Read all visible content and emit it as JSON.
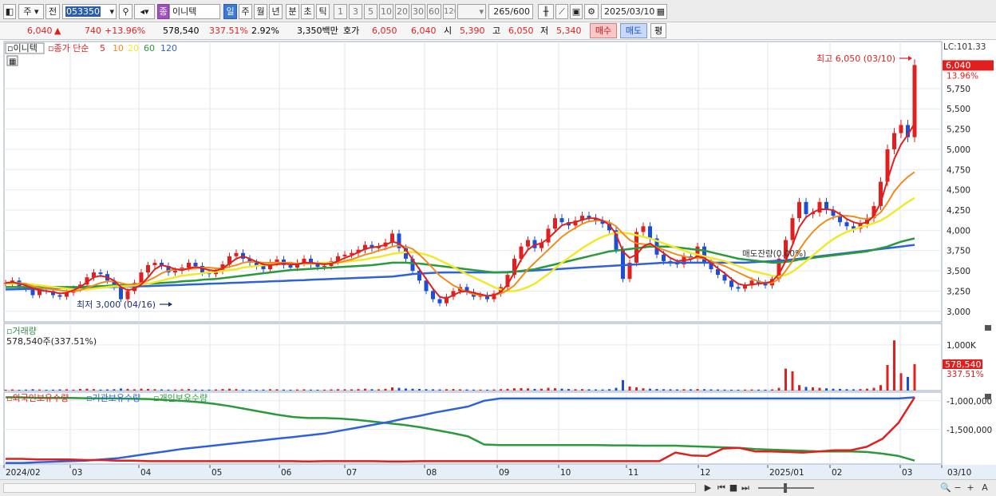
{
  "toolbar": {
    "market": "주",
    "prev_label": "전",
    "code": "053350",
    "stock_badge": "종",
    "stock_name": "이니텍",
    "periods": [
      "일",
      "주",
      "월",
      "년",
      "분",
      "초",
      "틱"
    ],
    "active_period": "일",
    "intervals": [
      "1",
      "3",
      "5",
      "10",
      "20",
      "30",
      "60",
      "120"
    ],
    "count": "265",
    "count_total": "/600",
    "date": "2025/03/10"
  },
  "quote": {
    "price": "6,040",
    "arrow": "▲",
    "change": "740",
    "change_pct": "+13.96%",
    "volume": "578,540",
    "volume_ratio": "337.51%",
    "turnover": "2.92%",
    "amount": "3,350백만",
    "ask_label": "호가",
    "ask": "6,050",
    "bid": "6,040",
    "open_label": "시",
    "open": "5,390",
    "high_label": "고",
    "high": "6,050",
    "low_label": "저",
    "low": "5,340",
    "buy_label": "매수",
    "sell_label": "매도",
    "avg_label": "평"
  },
  "colors": {
    "up": "#e0201e",
    "down": "#1b4fd8",
    "ma5": "#e0201e",
    "ma10": "#f08c1e",
    "ma20": "#f2e82a",
    "ma60": "#2a9a3c",
    "ma120": "#2f62d8",
    "foreign": "#e0201e",
    "institution": "#2f62d8",
    "individual": "#2a9a3c"
  },
  "chart_data": [
    {
      "type": "candlestick",
      "legend": {
        "name": "이니텍",
        "ma_title": "종가 단순",
        "periods": [
          "5",
          "10",
          "20",
          "60",
          "120"
        ]
      },
      "x_labels": [
        "2024/02",
        "03",
        "04",
        "05",
        "06",
        "07",
        "08",
        "09",
        "10",
        "11",
        "12",
        "2025/01",
        "02",
        "03",
        "03/10"
      ],
      "y_ticks": [
        "5,750",
        "5,500",
        "5,250",
        "5,000",
        "4,750",
        "4,500",
        "4,250",
        "4,000",
        "3,750",
        "3,500",
        "3,250",
        "3,000"
      ],
      "ylim": [
        2870,
        6330
      ],
      "top_label": "LC:101.33",
      "current_price_label": "6,040",
      "current_pct_label": "13.96%",
      "annotations": {
        "high": "최고 6,050 (03/10)",
        "low": "최저 3,000 (04/16)",
        "mid": "매도잔량(0.00%)"
      },
      "close_series": [
        3350,
        3380,
        3310,
        3280,
        3200,
        3260,
        3250,
        3200,
        3180,
        3230,
        3280,
        3330,
        3420,
        3480,
        3460,
        3380,
        3300,
        3150,
        3250,
        3350,
        3480,
        3570,
        3600,
        3560,
        3480,
        3500,
        3540,
        3600,
        3560,
        3480,
        3460,
        3500,
        3580,
        3680,
        3720,
        3650,
        3600,
        3560,
        3520,
        3600,
        3640,
        3570,
        3540,
        3600,
        3650,
        3580,
        3550,
        3560,
        3620,
        3680,
        3700,
        3720,
        3760,
        3820,
        3780,
        3800,
        3850,
        3960,
        3780,
        3650,
        3500,
        3380,
        3250,
        3150,
        3100,
        3180,
        3250,
        3300,
        3240,
        3180,
        3200,
        3150,
        3220,
        3300,
        3450,
        3650,
        3800,
        3880,
        3780,
        3850,
        4020,
        4150,
        4100,
        4060,
        4120,
        4180,
        4150,
        4120,
        4080,
        4000,
        3760,
        3400,
        3600,
        3980,
        4050,
        3900,
        3700,
        3620,
        3600,
        3580,
        3680,
        3650,
        3800,
        3600,
        3520,
        3450,
        3380,
        3300,
        3280,
        3320,
        3380,
        3350,
        3320,
        3400,
        3650,
        3880,
        4150,
        4350,
        4200,
        4220,
        4350,
        4250,
        4180,
        4100,
        4050,
        4020,
        4080,
        4150,
        4300,
        4600,
        5000,
        5200,
        5300,
        5150,
        6040
      ],
      "ma5_series": [
        3350,
        3360,
        3340,
        3320,
        3280,
        3260,
        3250,
        3240,
        3220,
        3230,
        3260,
        3300,
        3360,
        3420,
        3440,
        3420,
        3380,
        3300,
        3260,
        3280,
        3330,
        3420,
        3520,
        3570,
        3550,
        3520,
        3510,
        3530,
        3550,
        3530,
        3510,
        3500,
        3530,
        3590,
        3650,
        3680,
        3650,
        3610,
        3580,
        3570,
        3580,
        3590,
        3580,
        3580,
        3600,
        3600,
        3590,
        3580,
        3590,
        3620,
        3660,
        3690,
        3730,
        3770,
        3790,
        3800,
        3820,
        3860,
        3840,
        3760,
        3640,
        3520,
        3400,
        3280,
        3180,
        3160,
        3200,
        3240,
        3250,
        3230,
        3210,
        3190,
        3200,
        3240,
        3330,
        3480,
        3640,
        3760,
        3820,
        3840,
        3900,
        3980,
        4060,
        4090,
        4100,
        4130,
        4150,
        4150,
        4120,
        4070,
        3950,
        3740,
        3660,
        3700,
        3800,
        3840,
        3780,
        3720,
        3660,
        3620,
        3630,
        3640,
        3680,
        3660,
        3600,
        3530,
        3470,
        3400,
        3340,
        3320,
        3330,
        3340,
        3350,
        3370,
        3460,
        3620,
        3820,
        4040,
        4160,
        4220,
        4260,
        4260,
        4250,
        4200,
        4140,
        4100,
        4080,
        4100,
        4180,
        4340,
        4620,
        4880,
        5060,
        5180,
        5320
      ],
      "ma10_series": [
        3350,
        3355,
        3350,
        3340,
        3310,
        3290,
        3280,
        3270,
        3260,
        3250,
        3250,
        3260,
        3290,
        3320,
        3350,
        3370,
        3370,
        3350,
        3330,
        3330,
        3350,
        3380,
        3420,
        3470,
        3500,
        3520,
        3520,
        3520,
        3530,
        3540,
        3540,
        3530,
        3530,
        3550,
        3570,
        3600,
        3610,
        3610,
        3600,
        3600,
        3600,
        3600,
        3600,
        3590,
        3590,
        3590,
        3590,
        3590,
        3590,
        3600,
        3620,
        3640,
        3670,
        3700,
        3720,
        3750,
        3770,
        3800,
        3810,
        3800,
        3770,
        3700,
        3620,
        3530,
        3440,
        3380,
        3320,
        3280,
        3240,
        3210,
        3200,
        3190,
        3200,
        3220,
        3260,
        3320,
        3420,
        3520,
        3600,
        3680,
        3760,
        3840,
        3920,
        3980,
        4030,
        4080,
        4110,
        4120,
        4120,
        4100,
        4050,
        3960,
        3880,
        3840,
        3830,
        3820,
        3790,
        3760,
        3730,
        3700,
        3680,
        3660,
        3660,
        3650,
        3620,
        3590,
        3560,
        3520,
        3480,
        3440,
        3400,
        3370,
        3350,
        3350,
        3400,
        3500,
        3620,
        3760,
        3880,
        3980,
        4060,
        4120,
        4160,
        4180,
        4180,
        4170,
        4150,
        4140,
        4160,
        4220,
        4340,
        4480,
        4580,
        4660,
        4720
      ],
      "ma20_series": [
        3340,
        3340,
        3340,
        3335,
        3330,
        3320,
        3310,
        3300,
        3290,
        3280,
        3270,
        3270,
        3270,
        3280,
        3290,
        3300,
        3310,
        3310,
        3310,
        3320,
        3330,
        3340,
        3360,
        3380,
        3400,
        3420,
        3440,
        3450,
        3460,
        3470,
        3480,
        3490,
        3500,
        3510,
        3520,
        3540,
        3550,
        3560,
        3570,
        3580,
        3580,
        3590,
        3590,
        3590,
        3590,
        3590,
        3595,
        3600,
        3600,
        3600,
        3610,
        3620,
        3630,
        3640,
        3660,
        3670,
        3690,
        3710,
        3720,
        3730,
        3730,
        3720,
        3700,
        3670,
        3630,
        3590,
        3550,
        3500,
        3460,
        3420,
        3380,
        3340,
        3300,
        3270,
        3250,
        3250,
        3270,
        3300,
        3340,
        3400,
        3460,
        3530,
        3600,
        3660,
        3720,
        3780,
        3830,
        3880,
        3920,
        3950,
        3970,
        3970,
        3960,
        3940,
        3920,
        3900,
        3870,
        3840,
        3810,
        3780,
        3750,
        3720,
        3700,
        3680,
        3660,
        3640,
        3620,
        3590,
        3560,
        3530,
        3500,
        3480,
        3460,
        3440,
        3430,
        3450,
        3490,
        3550,
        3620,
        3690,
        3760,
        3830,
        3890,
        3940,
        3980,
        4010,
        4040,
        4060,
        4090,
        4120,
        4170,
        4230,
        4290,
        4350,
        4400
      ],
      "ma60_series": [
        3300,
        3300,
        3300,
        3300,
        3300,
        3300,
        3300,
        3300,
        3300,
        3300,
        3300,
        3300,
        3305,
        3310,
        3310,
        3315,
        3320,
        3320,
        3325,
        3330,
        3335,
        3340,
        3345,
        3350,
        3355,
        3360,
        3370,
        3375,
        3380,
        3390,
        3395,
        3400,
        3410,
        3420,
        3430,
        3440,
        3450,
        3460,
        3470,
        3480,
        3490,
        3500,
        3510,
        3515,
        3520,
        3525,
        3530,
        3535,
        3540,
        3545,
        3550,
        3555,
        3560,
        3565,
        3570,
        3580,
        3590,
        3600,
        3600,
        3600,
        3595,
        3590,
        3580,
        3570,
        3560,
        3550,
        3540,
        3530,
        3520,
        3510,
        3500,
        3490,
        3480,
        3480,
        3480,
        3490,
        3500,
        3510,
        3520,
        3540,
        3560,
        3580,
        3600,
        3620,
        3640,
        3660,
        3680,
        3700,
        3720,
        3740,
        3750,
        3760,
        3770,
        3780,
        3790,
        3800,
        3800,
        3800,
        3800,
        3790,
        3780,
        3770,
        3760,
        3750,
        3730,
        3710,
        3690,
        3670,
        3650,
        3640,
        3630,
        3620,
        3610,
        3600,
        3600,
        3610,
        3620,
        3640,
        3650,
        3660,
        3670,
        3680,
        3690,
        3700,
        3710,
        3720,
        3730,
        3740,
        3760,
        3780,
        3800,
        3830,
        3860,
        3880,
        3900
      ],
      "ma120_series": [
        3270,
        3272,
        3274,
        3276,
        3278,
        3280,
        3282,
        3284,
        3286,
        3288,
        3290,
        3292,
        3294,
        3296,
        3298,
        3300,
        3302,
        3304,
        3306,
        3308,
        3310,
        3312,
        3315,
        3318,
        3320,
        3323,
        3326,
        3330,
        3333,
        3336,
        3340,
        3343,
        3346,
        3350,
        3353,
        3356,
        3360,
        3363,
        3366,
        3370,
        3373,
        3376,
        3380,
        3383,
        3386,
        3390,
        3393,
        3396,
        3400,
        3403,
        3406,
        3410,
        3413,
        3416,
        3420,
        3423,
        3426,
        3430,
        3440,
        3450,
        3460,
        3465,
        3470,
        3475,
        3478,
        3480,
        3480,
        3480,
        3480,
        3480,
        3480,
        3480,
        3480,
        3482,
        3485,
        3490,
        3495,
        3500,
        3505,
        3510,
        3515,
        3520,
        3525,
        3530,
        3535,
        3540,
        3545,
        3550,
        3555,
        3560,
        3565,
        3570,
        3575,
        3580,
        3585,
        3590,
        3595,
        3600,
        3600,
        3600,
        3600,
        3600,
        3600,
        3600,
        3600,
        3600,
        3600,
        3600,
        3600,
        3600,
        3605,
        3610,
        3615,
        3620,
        3625,
        3630,
        3640,
        3650,
        3660,
        3670,
        3680,
        3690,
        3700,
        3710,
        3720,
        3730,
        3740,
        3750,
        3760,
        3770,
        3780,
        3790,
        3800,
        3810,
        3820
      ]
    },
    {
      "type": "bar",
      "title": "거래량",
      "summary": "578,540주(337.51%)",
      "y_ticks": [
        "1,000K"
      ],
      "ylim": [
        0,
        1400000
      ],
      "current_label": "578,540",
      "current_pct_label": "337.51%",
      "values": [
        20000,
        25000,
        18000,
        22000,
        30000,
        24000,
        19000,
        21000,
        26000,
        28000,
        20000,
        35000,
        40000,
        32000,
        22000,
        25000,
        30000,
        45000,
        38000,
        28000,
        42000,
        36000,
        30000,
        26000,
        22000,
        24000,
        28000,
        33000,
        25000,
        20000,
        22000,
        26000,
        34000,
        40000,
        32000,
        24000,
        21000,
        20000,
        23000,
        30000,
        28000,
        22000,
        20000,
        24000,
        27000,
        22000,
        20000,
        21000,
        26000,
        30000,
        28000,
        27000,
        32000,
        40000,
        30000,
        28000,
        38000,
        70000,
        60000,
        45000,
        40000,
        36000,
        30000,
        28000,
        25000,
        30000,
        34000,
        28000,
        24000,
        22000,
        22000,
        20000,
        24000,
        30000,
        38000,
        50000,
        55000,
        48000,
        36000,
        40000,
        60000,
        52000,
        42000,
        34000,
        30000,
        32000,
        28000,
        26000,
        24000,
        30000,
        60000,
        230000,
        90000,
        70000,
        50000,
        40000,
        34000,
        30000,
        28000,
        26000,
        30000,
        28000,
        34000,
        30000,
        26000,
        24000,
        22000,
        20000,
        20000,
        22000,
        24000,
        22000,
        20000,
        26000,
        60000,
        480000,
        420000,
        120000,
        80000,
        70000,
        60000,
        50000,
        40000,
        36000,
        30000,
        28000,
        32000,
        40000,
        60000,
        120000,
        560000,
        1100000,
        380000,
        300000,
        578540
      ]
    },
    {
      "type": "line",
      "series": [
        {
          "name": "외국인보유수량",
          "color": "#e0201e"
        },
        {
          "name": "기관보유수량",
          "color": "#2f62d8"
        },
        {
          "name": "개인보유수량",
          "color": "#2a9a3c"
        }
      ],
      "y_ticks": [
        "-1,000,000",
        "-1,500,000"
      ],
      "ylim": [
        -2100000,
        -850000
      ],
      "foreign_values": [
        -2010000,
        -2010000,
        -2020000,
        -2020000,
        -2020000,
        -2030000,
        -2030000,
        -2040000,
        -2040000,
        -2050000,
        -2050000,
        -2050000,
        -2050000,
        -2050000,
        -2050000,
        -2050000,
        -2050000,
        -2050000,
        -2050000,
        -2055000,
        -2050000,
        -2050000,
        -2050000,
        -2050000,
        -2055000,
        -2055000,
        -2050000,
        -2050000,
        -2050000,
        -2050000,
        -2050000,
        -2050000,
        -2050000,
        -2050000,
        -2050000,
        -2050000,
        -2050000,
        -2050000,
        -2050000,
        -2050000,
        -2050000,
        -2050000,
        -1900000,
        -1950000,
        -1960000,
        -1830000,
        -1820000,
        -1880000,
        -1880000,
        -1890000,
        -1900000,
        -1880000,
        -1860000,
        -1860000,
        -1800000,
        -1660000,
        -1380000,
        -940000
      ],
      "institution_values": [
        -2080000,
        -2080000,
        -2070000,
        -2060000,
        -2050000,
        -2040000,
        -2020000,
        -2000000,
        -1960000,
        -1920000,
        -1880000,
        -1840000,
        -1810000,
        -1780000,
        -1750000,
        -1720000,
        -1690000,
        -1660000,
        -1630000,
        -1600000,
        -1570000,
        -1520000,
        -1470000,
        -1420000,
        -1370000,
        -1310000,
        -1260000,
        -1200000,
        -1150000,
        -1100000,
        -1000000,
        -960000,
        -960000,
        -960000,
        -960000,
        -960000,
        -960000,
        -960000,
        -960000,
        -960000,
        -960000,
        -960000,
        -960000,
        -960000,
        -960000,
        -960000,
        -960000,
        -960000,
        -960000,
        -960000,
        -960000,
        -960000,
        -960000,
        -960000,
        -960000,
        -960000,
        -960000,
        -940000
      ],
      "individual_values": [
        -940000,
        -940000,
        -950000,
        -950000,
        -950000,
        -955000,
        -960000,
        -960000,
        -965000,
        -970000,
        -985000,
        -1000000,
        -1020000,
        -1050000,
        -1090000,
        -1140000,
        -1190000,
        -1240000,
        -1280000,
        -1300000,
        -1300000,
        -1310000,
        -1330000,
        -1360000,
        -1390000,
        -1420000,
        -1460000,
        -1510000,
        -1560000,
        -1620000,
        -1760000,
        -1770000,
        -1770000,
        -1770000,
        -1770000,
        -1770000,
        -1770000,
        -1770000,
        -1775000,
        -1775000,
        -1780000,
        -1780000,
        -1780000,
        -1790000,
        -1800000,
        -1810000,
        -1820000,
        -1840000,
        -1850000,
        -1860000,
        -1870000,
        -1880000,
        -1880000,
        -1880000,
        -1890000,
        -1920000,
        -1960000,
        -2040000
      ]
    }
  ],
  "bottom_controls": [
    "▶",
    "⏮",
    "■",
    "⏭",
    "🔍",
    "−",
    "+",
    "A"
  ]
}
